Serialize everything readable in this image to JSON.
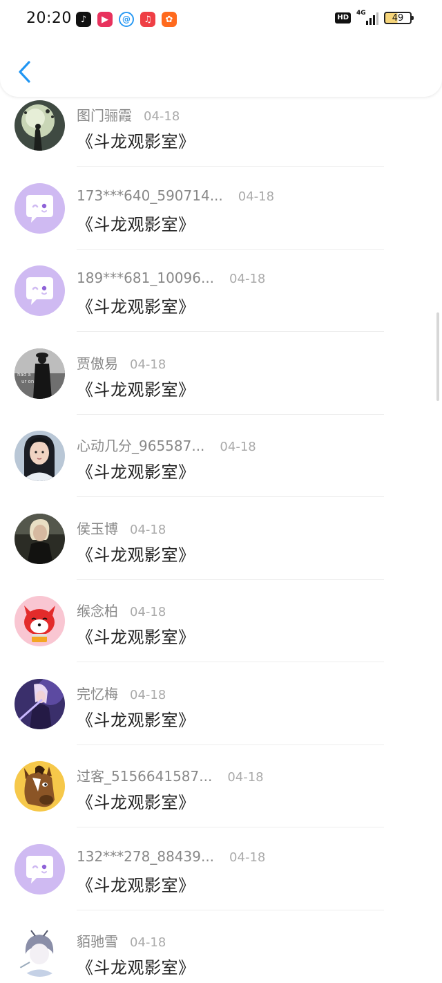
{
  "status_bar": {
    "time": "20:20",
    "app_icons": [
      "tiktok-icon",
      "video-play-icon",
      "search-browser-icon",
      "music-icon",
      "kuaishou-icon"
    ],
    "hd_label": "HD",
    "network": "4G",
    "battery": "49"
  },
  "nav": {
    "back_icon": "chevron-left-icon",
    "accent_color": "#2196f3"
  },
  "colors": {
    "username": "#888888",
    "date": "#aaaaaa",
    "message": "#222222",
    "default_avatar_bg": "#cfbaf2"
  },
  "comments": [
    {
      "username": "图门骊霞",
      "date": "04-18",
      "message": "《斗龙观影室》",
      "avatar": "dark-silhouette-avatar"
    },
    {
      "username": "173***640_590714...",
      "date": "04-18",
      "message": "《斗龙观影室》",
      "avatar": "default-chat-bubble-avatar"
    },
    {
      "username": "189***681_10096...",
      "date": "04-18",
      "message": "《斗龙观影室》",
      "avatar": "default-chat-bubble-avatar"
    },
    {
      "username": "贾傲易",
      "date": "04-18",
      "message": "《斗龙观影室》",
      "avatar": "black-white-figure-avatar"
    },
    {
      "username": "心动几分_965587...",
      "date": "04-18",
      "message": "《斗龙观影室》",
      "avatar": "costume-portrait-avatar"
    },
    {
      "username": "侯玉博",
      "date": "04-18",
      "message": "《斗龙观影室》",
      "avatar": "dark-portrait-avatar"
    },
    {
      "username": "缑念柏",
      "date": "04-18",
      "message": "《斗龙观影室》",
      "avatar": "red-fox-cartoon-avatar"
    },
    {
      "username": "完忆梅",
      "date": "04-18",
      "message": "《斗龙观影室》",
      "avatar": "purple-game-character-avatar"
    },
    {
      "username": "过客_5156641587...",
      "date": "04-18",
      "message": "《斗龙观影室》",
      "avatar": "horse-cartoon-avatar"
    },
    {
      "username": "132***278_88439...",
      "date": "04-18",
      "message": "《斗龙观影室》",
      "avatar": "default-chat-bubble-avatar"
    },
    {
      "username": "貊驰雪",
      "date": "04-18",
      "message": "《斗龙观影室》",
      "avatar": "pale-anime-avatar"
    }
  ]
}
